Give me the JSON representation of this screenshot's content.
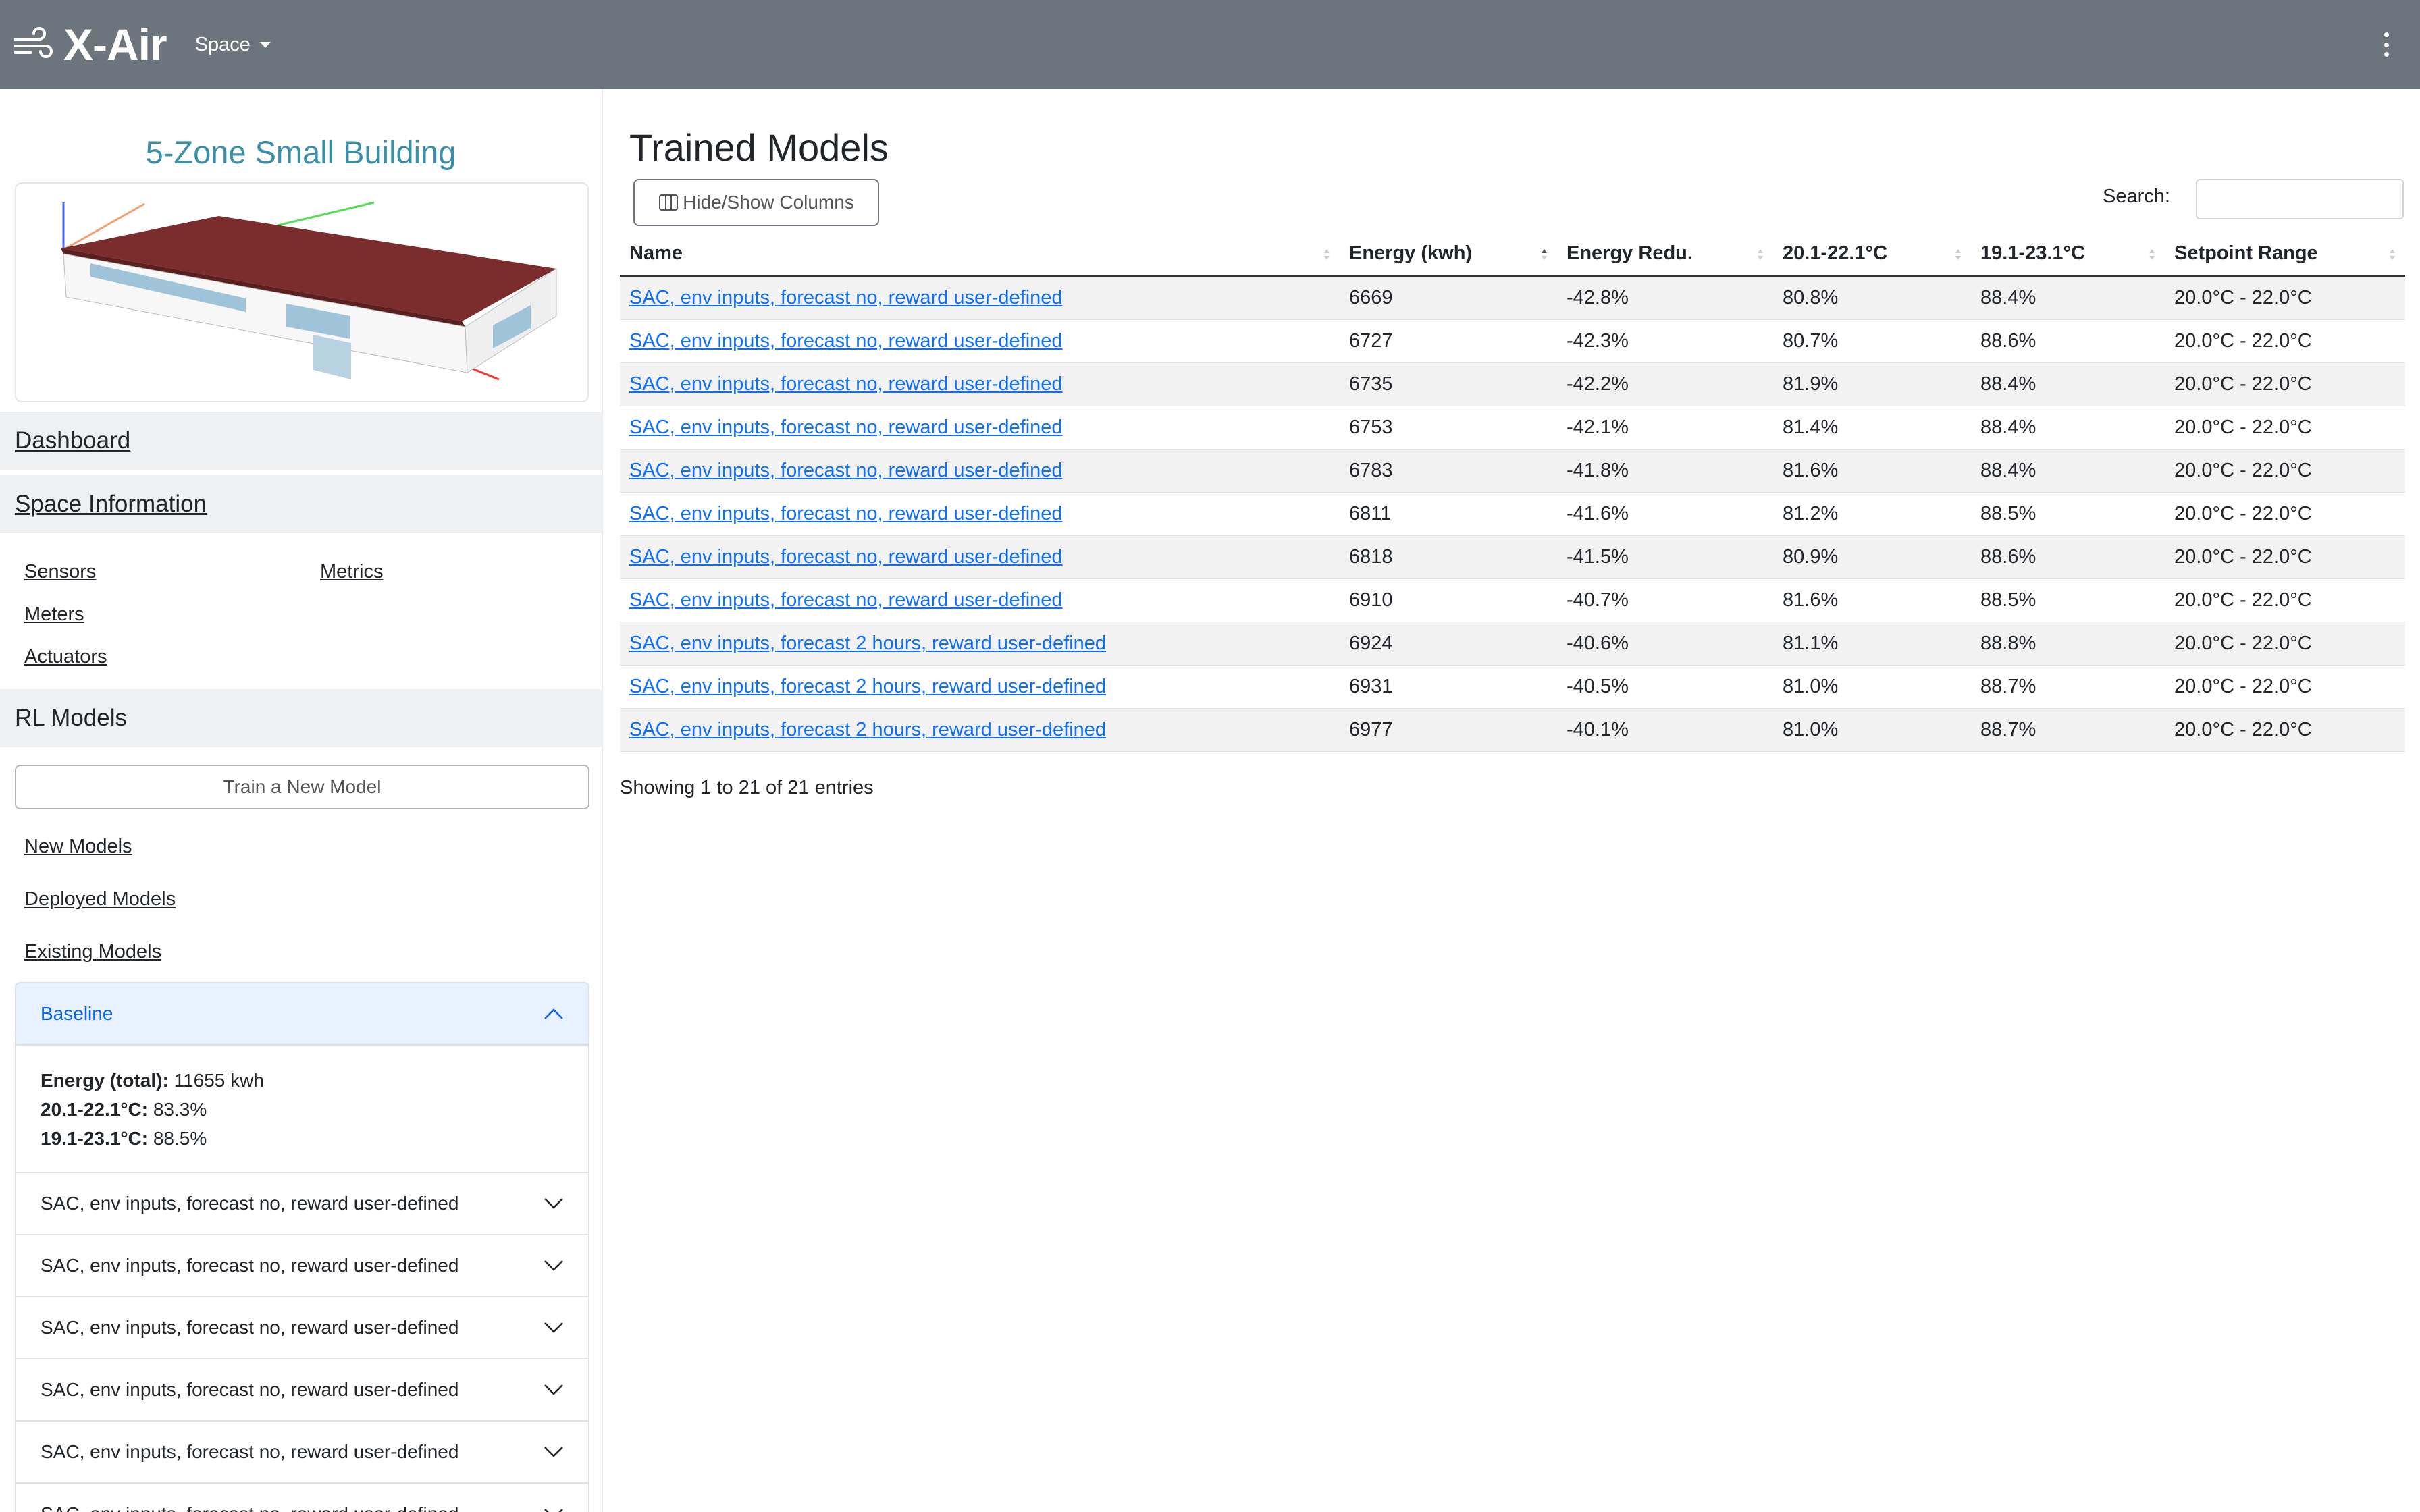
{
  "navbar": {
    "brand": "X-Air",
    "space_menu": "Space"
  },
  "sidebar": {
    "building_title": "5-Zone Small Building",
    "dashboard": "Dashboard",
    "space_information": "Space Information",
    "space_links": {
      "sensors": "Sensors",
      "metrics": "Metrics",
      "meters": "Meters",
      "actuators": "Actuators"
    },
    "rl_models": "RL Models",
    "train_button": "Train a New Model",
    "model_links": {
      "new": "New Models",
      "deployed": "Deployed Models",
      "existing": "Existing Models"
    },
    "baseline": {
      "title": "Baseline",
      "energy_label": "Energy (total):",
      "energy_value": "11655 kwh",
      "range1_label": "20.1-22.1°C:",
      "range1_value": "83.3%",
      "range2_label": "19.1-23.1°C:",
      "range2_value": "88.5%"
    },
    "accordion_items": [
      "SAC, env inputs, forecast no, reward user-defined",
      "SAC, env inputs, forecast no, reward user-defined",
      "SAC, env inputs, forecast no, reward user-defined",
      "SAC, env inputs, forecast no, reward user-defined",
      "SAC, env inputs, forecast no, reward user-defined",
      "SAC, env inputs, forecast no, reward user-defined"
    ]
  },
  "main": {
    "title": "Trained Models",
    "hide_show_button": "Hide/Show Columns",
    "search_label": "Search:",
    "columns": [
      "Name",
      "Energy (kwh)",
      "Energy Redu.",
      "20.1-22.1°C",
      "19.1-23.1°C",
      "Setpoint Range"
    ],
    "rows": [
      [
        "SAC, env inputs, forecast no, reward user-defined",
        "6669",
        "-42.8%",
        "80.8%",
        "88.4%",
        "20.0°C - 22.0°C"
      ],
      [
        "SAC, env inputs, forecast no, reward user-defined",
        "6727",
        "-42.3%",
        "80.7%",
        "88.6%",
        "20.0°C - 22.0°C"
      ],
      [
        "SAC, env inputs, forecast no, reward user-defined",
        "6735",
        "-42.2%",
        "81.9%",
        "88.4%",
        "20.0°C - 22.0°C"
      ],
      [
        "SAC, env inputs, forecast no, reward user-defined",
        "6753",
        "-42.1%",
        "81.4%",
        "88.4%",
        "20.0°C - 22.0°C"
      ],
      [
        "SAC, env inputs, forecast no, reward user-defined",
        "6783",
        "-41.8%",
        "81.6%",
        "88.4%",
        "20.0°C - 22.0°C"
      ],
      [
        "SAC, env inputs, forecast no, reward user-defined",
        "6811",
        "-41.6%",
        "81.2%",
        "88.5%",
        "20.0°C - 22.0°C"
      ],
      [
        "SAC, env inputs, forecast no, reward user-defined",
        "6818",
        "-41.5%",
        "80.9%",
        "88.6%",
        "20.0°C - 22.0°C"
      ],
      [
        "SAC, env inputs, forecast no, reward user-defined",
        "6910",
        "-40.7%",
        "81.6%",
        "88.5%",
        "20.0°C - 22.0°C"
      ],
      [
        "SAC, env inputs, forecast 2 hours, reward user-defined",
        "6924",
        "-40.6%",
        "81.1%",
        "88.8%",
        "20.0°C - 22.0°C"
      ],
      [
        "SAC, env inputs, forecast 2 hours, reward user-defined",
        "6931",
        "-40.5%",
        "81.0%",
        "88.7%",
        "20.0°C - 22.0°C"
      ],
      [
        "SAC, env inputs, forecast 2 hours, reward user-defined",
        "6977",
        "-40.1%",
        "81.0%",
        "88.7%",
        "20.0°C - 22.0°C"
      ]
    ],
    "info": "Showing 1 to 21 of 21 entries"
  },
  "colors": {
    "navbar": "#6c757d",
    "title_teal": "#3a8fa8",
    "link": "#0d6efd",
    "active_accordion": "#e7f1ff"
  }
}
